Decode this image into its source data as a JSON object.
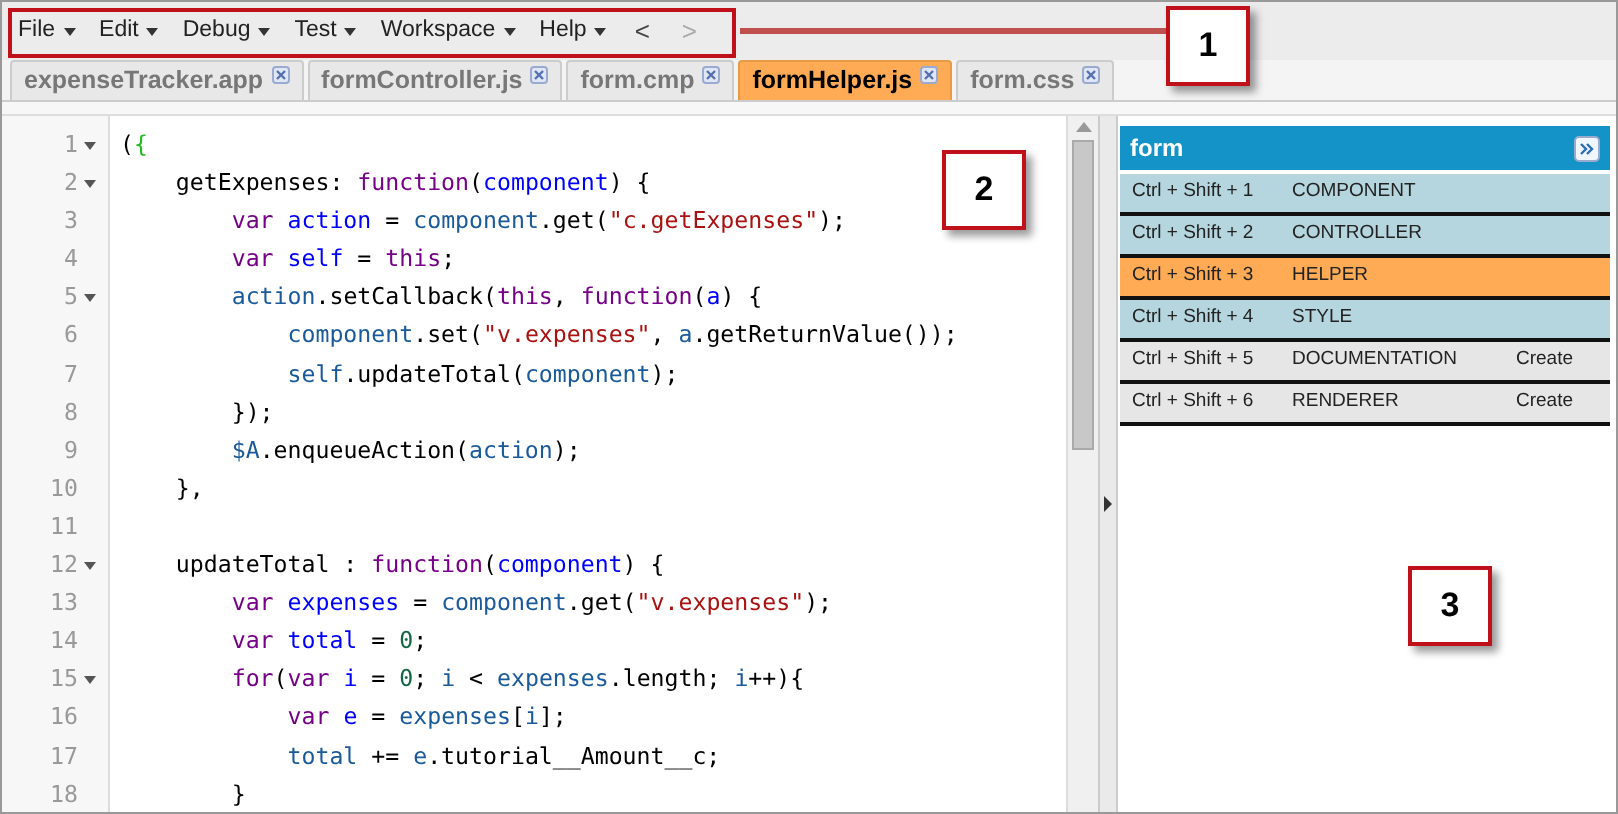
{
  "menu": [
    {
      "label": "File"
    },
    {
      "label": "Edit"
    },
    {
      "label": "Debug"
    },
    {
      "label": "Test"
    },
    {
      "label": "Workspace"
    },
    {
      "label": "Help"
    }
  ],
  "nav": [
    {
      "label": "<",
      "disabled": false
    },
    {
      "label": ">",
      "disabled": true
    }
  ],
  "tabs": [
    {
      "label": "expenseTracker.app",
      "selected": false
    },
    {
      "label": "formController.js",
      "selected": false
    },
    {
      "label": "form.cmp",
      "selected": false
    },
    {
      "label": "formHelper.js",
      "selected": true
    },
    {
      "label": "form.css",
      "selected": false
    }
  ],
  "editor": {
    "lines": [
      {
        "number": "1",
        "fold": true,
        "tokens": [
          {
            "text": "(",
            "kind": "plain"
          },
          {
            "text": "{",
            "kind": "bracket"
          }
        ]
      },
      {
        "number": "2",
        "fold": true,
        "tokens": [
          {
            "text": "    getExpenses: ",
            "kind": "plain"
          },
          {
            "text": "function",
            "kind": "kw"
          },
          {
            "text": "(",
            "kind": "plain"
          },
          {
            "text": "component",
            "kind": "def"
          },
          {
            "text": ") {",
            "kind": "plain"
          }
        ]
      },
      {
        "number": "3",
        "fold": false,
        "tokens": [
          {
            "text": "        var ",
            "kind": "kw"
          },
          {
            "text": "action",
            "kind": "def"
          },
          {
            "text": " = ",
            "kind": "plain"
          },
          {
            "text": "component",
            "kind": "var"
          },
          {
            "text": ".get(",
            "kind": "plain"
          },
          {
            "text": "\"c.getExpenses\"",
            "kind": "str"
          },
          {
            "text": ");",
            "kind": "plain"
          }
        ]
      },
      {
        "number": "4",
        "fold": false,
        "tokens": [
          {
            "text": "        var ",
            "kind": "kw"
          },
          {
            "text": "self",
            "kind": "def"
          },
          {
            "text": " = ",
            "kind": "plain"
          },
          {
            "text": "this",
            "kind": "kw"
          },
          {
            "text": ";",
            "kind": "plain"
          }
        ]
      },
      {
        "number": "5",
        "fold": true,
        "tokens": [
          {
            "text": "        action",
            "kind": "var"
          },
          {
            "text": ".setCallback(",
            "kind": "plain"
          },
          {
            "text": "this",
            "kind": "kw"
          },
          {
            "text": ", ",
            "kind": "plain"
          },
          {
            "text": "function",
            "kind": "kw"
          },
          {
            "text": "(",
            "kind": "plain"
          },
          {
            "text": "a",
            "kind": "def"
          },
          {
            "text": ") {",
            "kind": "plain"
          }
        ]
      },
      {
        "number": "6",
        "fold": false,
        "tokens": [
          {
            "text": "            component",
            "kind": "var"
          },
          {
            "text": ".set(",
            "kind": "plain"
          },
          {
            "text": "\"v.expenses\"",
            "kind": "str"
          },
          {
            "text": ", ",
            "kind": "plain"
          },
          {
            "text": "a",
            "kind": "var"
          },
          {
            "text": ".getReturnValue());",
            "kind": "plain"
          }
        ]
      },
      {
        "number": "7",
        "fold": false,
        "tokens": [
          {
            "text": "            self",
            "kind": "var"
          },
          {
            "text": ".updateTotal(",
            "kind": "plain"
          },
          {
            "text": "component",
            "kind": "var"
          },
          {
            "text": ");",
            "kind": "plain"
          }
        ]
      },
      {
        "number": "8",
        "fold": false,
        "tokens": [
          {
            "text": "        });",
            "kind": "plain"
          }
        ]
      },
      {
        "number": "9",
        "fold": false,
        "tokens": [
          {
            "text": "        $A",
            "kind": "var"
          },
          {
            "text": ".enqueueAction(",
            "kind": "plain"
          },
          {
            "text": "action",
            "kind": "var"
          },
          {
            "text": ");",
            "kind": "plain"
          }
        ]
      },
      {
        "number": "10",
        "fold": false,
        "tokens": [
          {
            "text": "    },",
            "kind": "plain"
          }
        ]
      },
      {
        "number": "11",
        "fold": false
      },
      {
        "number": "12",
        "fold": true,
        "tokens": [
          {
            "text": "    updateTotal : ",
            "kind": "plain"
          },
          {
            "text": "function",
            "kind": "kw"
          },
          {
            "text": "(",
            "kind": "plain"
          },
          {
            "text": "component",
            "kind": "def"
          },
          {
            "text": ") {",
            "kind": "plain"
          }
        ]
      },
      {
        "number": "13",
        "fold": false,
        "tokens": [
          {
            "text": "        var ",
            "kind": "kw"
          },
          {
            "text": "expenses",
            "kind": "def"
          },
          {
            "text": " = ",
            "kind": "plain"
          },
          {
            "text": "component",
            "kind": "var"
          },
          {
            "text": ".get(",
            "kind": "plain"
          },
          {
            "text": "\"v.expenses\"",
            "kind": "str"
          },
          {
            "text": ");",
            "kind": "plain"
          }
        ]
      },
      {
        "number": "14",
        "fold": false,
        "tokens": [
          {
            "text": "        var ",
            "kind": "kw"
          },
          {
            "text": "total",
            "kind": "def"
          },
          {
            "text": " = ",
            "kind": "plain"
          },
          {
            "text": "0",
            "kind": "num"
          },
          {
            "text": ";",
            "kind": "plain"
          }
        ]
      },
      {
        "number": "15",
        "fold": true,
        "tokens": [
          {
            "text": "        for",
            "kind": "kw"
          },
          {
            "text": "(",
            "kind": "plain"
          },
          {
            "text": "var ",
            "kind": "kw"
          },
          {
            "text": "i",
            "kind": "def"
          },
          {
            "text": " = ",
            "kind": "plain"
          },
          {
            "text": "0",
            "kind": "num"
          },
          {
            "text": "; ",
            "kind": "plain"
          },
          {
            "text": "i",
            "kind": "var"
          },
          {
            "text": " < ",
            "kind": "plain"
          },
          {
            "text": "expenses",
            "kind": "var"
          },
          {
            "text": ".length; ",
            "kind": "plain"
          },
          {
            "text": "i",
            "kind": "var"
          },
          {
            "text": "++){",
            "kind": "plain"
          }
        ]
      },
      {
        "number": "16",
        "fold": false,
        "tokens": [
          {
            "text": "            var ",
            "kind": "kw"
          },
          {
            "text": "e",
            "kind": "def"
          },
          {
            "text": " = ",
            "kind": "plain"
          },
          {
            "text": "expenses",
            "kind": "var"
          },
          {
            "text": "[",
            "kind": "plain"
          },
          {
            "text": "i",
            "kind": "var"
          },
          {
            "text": "];",
            "kind": "plain"
          }
        ]
      },
      {
        "number": "17",
        "fold": false,
        "tokens": [
          {
            "text": "            total",
            "kind": "var"
          },
          {
            "text": " += ",
            "kind": "plain"
          },
          {
            "text": "e",
            "kind": "var"
          },
          {
            "text": ".tutorial__Amount__c;",
            "kind": "plain"
          }
        ]
      },
      {
        "number": "18",
        "fold": false,
        "tokens": [
          {
            "text": "        }",
            "kind": "plain"
          }
        ]
      }
    ]
  },
  "panel": {
    "title": "form",
    "rows": [
      {
        "shortcut": "Ctrl + Shift + 1",
        "name": "COMPONENT",
        "exists": true,
        "selected": false
      },
      {
        "shortcut": "Ctrl + Shift + 2",
        "name": "CONTROLLER",
        "exists": true,
        "selected": false
      },
      {
        "shortcut": "Ctrl + Shift + 3",
        "name": "HELPER",
        "exists": true,
        "selected": true
      },
      {
        "shortcut": "Ctrl + Shift + 4",
        "name": "STYLE",
        "exists": true,
        "selected": false
      },
      {
        "shortcut": "Ctrl + Shift + 5",
        "name": "DOCUMENTATION",
        "exists": false,
        "selected": false,
        "action": "Create"
      },
      {
        "shortcut": "Ctrl + Shift + 6",
        "name": "RENDERER",
        "exists": false,
        "selected": false,
        "action": "Create"
      }
    ]
  },
  "callouts": [
    "1",
    "2",
    "3"
  ]
}
